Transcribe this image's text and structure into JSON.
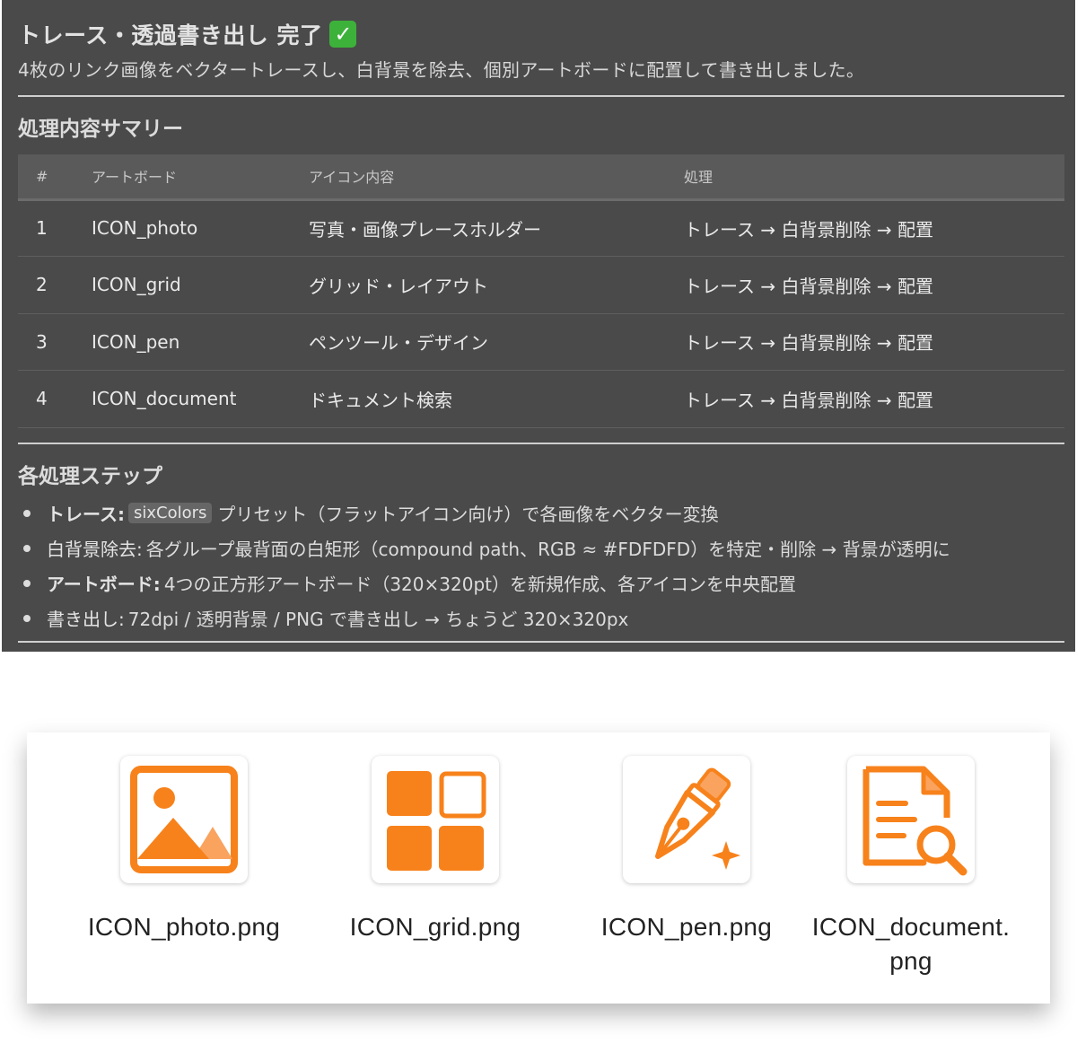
{
  "header": {
    "title": "トレース・透過書き出し 完了",
    "check_glyph": "✓",
    "subtitle": "4枚のリンク画像をベクタートレースし、白背景を除去、個別アートボードに配置して書き出しました。"
  },
  "summary": {
    "title": "処理内容サマリー",
    "columns": [
      "#",
      "アートボード",
      "アイコン内容",
      "処理"
    ],
    "rows": [
      [
        "1",
        "ICON_photo",
        "写真・画像プレースホルダー",
        "トレース → 白背景削除 → 配置"
      ],
      [
        "2",
        "ICON_grid",
        "グリッド・レイアウト",
        "トレース → 白背景削除 → 配置"
      ],
      [
        "3",
        "ICON_pen",
        "ペンツール・デザイン",
        "トレース → 白背景削除 → 配置"
      ],
      [
        "4",
        "ICON_document",
        "ドキュメント検索",
        "トレース → 白背景削除 → 配置"
      ]
    ]
  },
  "steps": {
    "title": "各処理ステップ",
    "items": [
      {
        "label": "トレース:",
        "code": "sixColors",
        "text": "プリセット（フラットアイコン向け）で各画像をベクター変換"
      },
      {
        "label": "白背景除去:",
        "code": "",
        "text": "各グループ最背面の白矩形（compound path、RGB ≈ #FDFDFD）を特定・削除 → 背景が透明に"
      },
      {
        "label": "アートボード:",
        "code": "",
        "text": "4つの正方形アートボード（320×320pt）を新規作成、各アイコンを中央配置"
      },
      {
        "label": "書き出し:",
        "code": "",
        "text": "72dpi / 透明背景 / PNG で書き出し → ちょうど 320×320px"
      }
    ]
  },
  "files": [
    {
      "name": "ICON_photo.png",
      "icon": "photo-icon"
    },
    {
      "name": "ICON_grid.png",
      "icon": "grid-icon"
    },
    {
      "name": "ICON_pen.png",
      "icon": "pen-icon"
    },
    {
      "name": "ICON_document.\npng",
      "icon": "document-search-icon"
    }
  ],
  "colors": {
    "panel_bg": "#4a4a4a",
    "accent_orange": "#f7821b",
    "check_green": "#3db23a"
  }
}
